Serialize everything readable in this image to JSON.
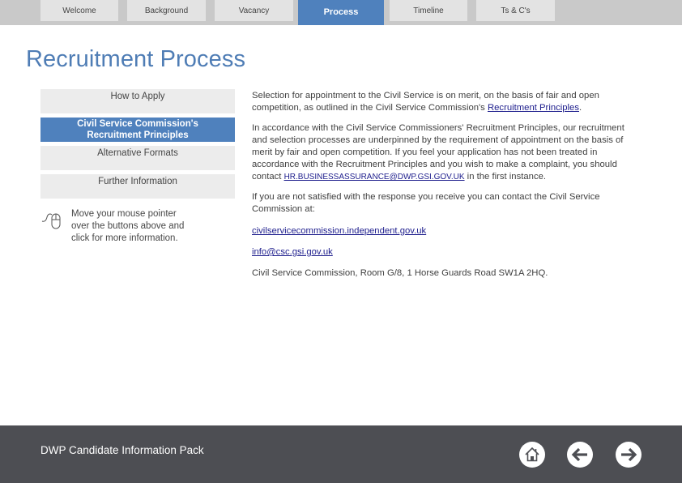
{
  "tabs": [
    {
      "label": "Welcome",
      "active": false
    },
    {
      "label": "Background",
      "active": false
    },
    {
      "label": "Vacancy",
      "active": false
    },
    {
      "label": "Process",
      "active": true
    },
    {
      "label": "Timeline",
      "active": false
    },
    {
      "label": "Ts & C's",
      "active": false
    }
  ],
  "page_title": "Recruitment Process",
  "side_buttons": [
    {
      "label": "How to Apply",
      "active": false
    },
    {
      "label_line1": "Civil Service Commission's",
      "label_line2": "Recruitment Principles",
      "active": true
    },
    {
      "label": "Alternative Formats",
      "active": false
    },
    {
      "label": "Further Information",
      "active": false
    }
  ],
  "hint": {
    "icon": "mouse-icon",
    "text_line1": "Move your mouse pointer",
    "text_line2": "over the buttons above and",
    "text_line3": "click for more information."
  },
  "content": {
    "para1_text": "Selection for appointment to the Civil Service is on merit, on the basis of fair and open competition, as outlined in the Civil Service Commission's ",
    "para1_link": "Recruitment Principles",
    "para1_end": ".",
    "para2_text": "In accordance with the Civil Service Commissioners' Recruitment Principles, our recruitment and selection processes are underpinned by the requirement of appointment on the basis of merit by fair and open competition. If you feel your application has not been treated in accordance with the Recruitment Principles and you wish to make a complaint, you should contact ",
    "para2_link": "HR.BUSINESSASSURANCE@DWP.GSI.GOV.UK",
    "para2_end": " in the first instance.",
    "para3_text": "If you are not satisfied with the response you receive you can contact the Civil Service Commission at:",
    "website_link": "civilservicecommission.independent.gov.uk",
    "email_link": "info@csc.gsi.gov.uk",
    "address": "Civil Service Commission, Room G/8, 1 Horse Guards Road SW1A 2HQ."
  },
  "footer": {
    "title": "DWP Candidate Information Pack",
    "buttons": [
      {
        "icon": "home-icon",
        "label": "Home"
      },
      {
        "icon": "arrow-left-icon",
        "label": "Back"
      },
      {
        "icon": "arrow-right-icon",
        "label": "Next"
      }
    ]
  },
  "colors": {
    "accent": "#4f81bd",
    "title": "#4f7db5",
    "tab_bar": "#c9c9c9",
    "tab": "#e3e3e3",
    "side_button": "#ececec",
    "footer": "#4d4e53",
    "link": "#1c1c8c"
  }
}
